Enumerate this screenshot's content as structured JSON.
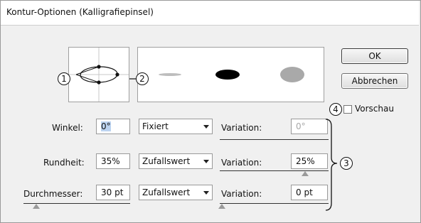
{
  "window": {
    "title": "Kontur-Optionen (Kalligrafiepinsel)"
  },
  "buttons": {
    "ok": "OK",
    "cancel": "Abbrechen"
  },
  "preview": {
    "label": "Vorschau",
    "checked": false
  },
  "callouts": [
    "1",
    "2",
    "3",
    "4"
  ],
  "rows": [
    {
      "label": "Winkel:",
      "value": "0°",
      "mode": "Fixiert",
      "variation_label": "Variation:",
      "variation": "0°",
      "variation_disabled": true
    },
    {
      "label": "Rundheit:",
      "value": "35%",
      "mode": "Zufallswert",
      "variation_label": "Variation:",
      "variation": "25%",
      "variation_disabled": false
    },
    {
      "label": "Durchmesser:",
      "value": "30 pt",
      "mode": "Zufallswert",
      "variation_label": "Variation:",
      "variation": "0 pt",
      "variation_disabled": false
    }
  ]
}
